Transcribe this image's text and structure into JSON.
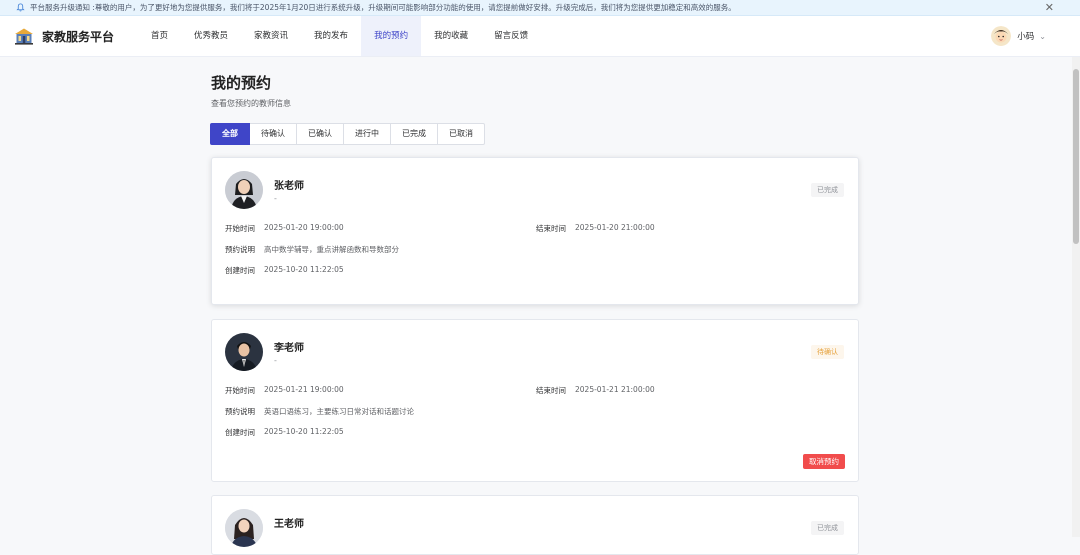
{
  "notice": {
    "text": "平台服务升级通知 :尊敬的用户，为了更好地为您提供服务，我们将于2025年1月20日进行系统升级，升级期间可能影响部分功能的使用，请您提前做好安排。升级完成后，我们将为您提供更加稳定和高效的服务。",
    "close": "✕"
  },
  "header": {
    "brand": "家教服务平台",
    "nav": [
      "首页",
      "优秀教员",
      "家教资讯",
      "我的发布",
      "我的预约",
      "我的收藏",
      "留言反馈"
    ],
    "active_nav": "我的预约",
    "user_name": "小码",
    "chevron": "⌄"
  },
  "page": {
    "title": "我的预约",
    "subtitle": "查看您预约的教师信息"
  },
  "tabs": [
    "全部",
    "待确认",
    "已确认",
    "进行中",
    "已完成",
    "已取消"
  ],
  "labels": {
    "start": "开始时间",
    "end": "结束时间",
    "desc": "预约说明",
    "created": "创建时间",
    "cancel": "取消预约"
  },
  "appointments": [
    {
      "teacher": "张老师",
      "dash": "-",
      "status": "已完成",
      "start": "2025-01-20 19:00:00",
      "end": "2025-01-20 21:00:00",
      "desc": "高中数学辅导，重点讲解函数和导数部分",
      "created": "2025-10-20 11:22:05"
    },
    {
      "teacher": "李老师",
      "dash": "-",
      "status": "待确认",
      "start": "2025-01-21 19:00:00",
      "end": "2025-01-21 21:00:00",
      "desc": "英语口语练习，主要练习日常对话和话题讨论",
      "created": "2025-10-20 11:22:05"
    },
    {
      "teacher": "王老师",
      "status": "已完成"
    }
  ],
  "colors": {
    "accent": "#3f45c8",
    "danger": "#f14c4c",
    "warning": "#e6a23c"
  }
}
